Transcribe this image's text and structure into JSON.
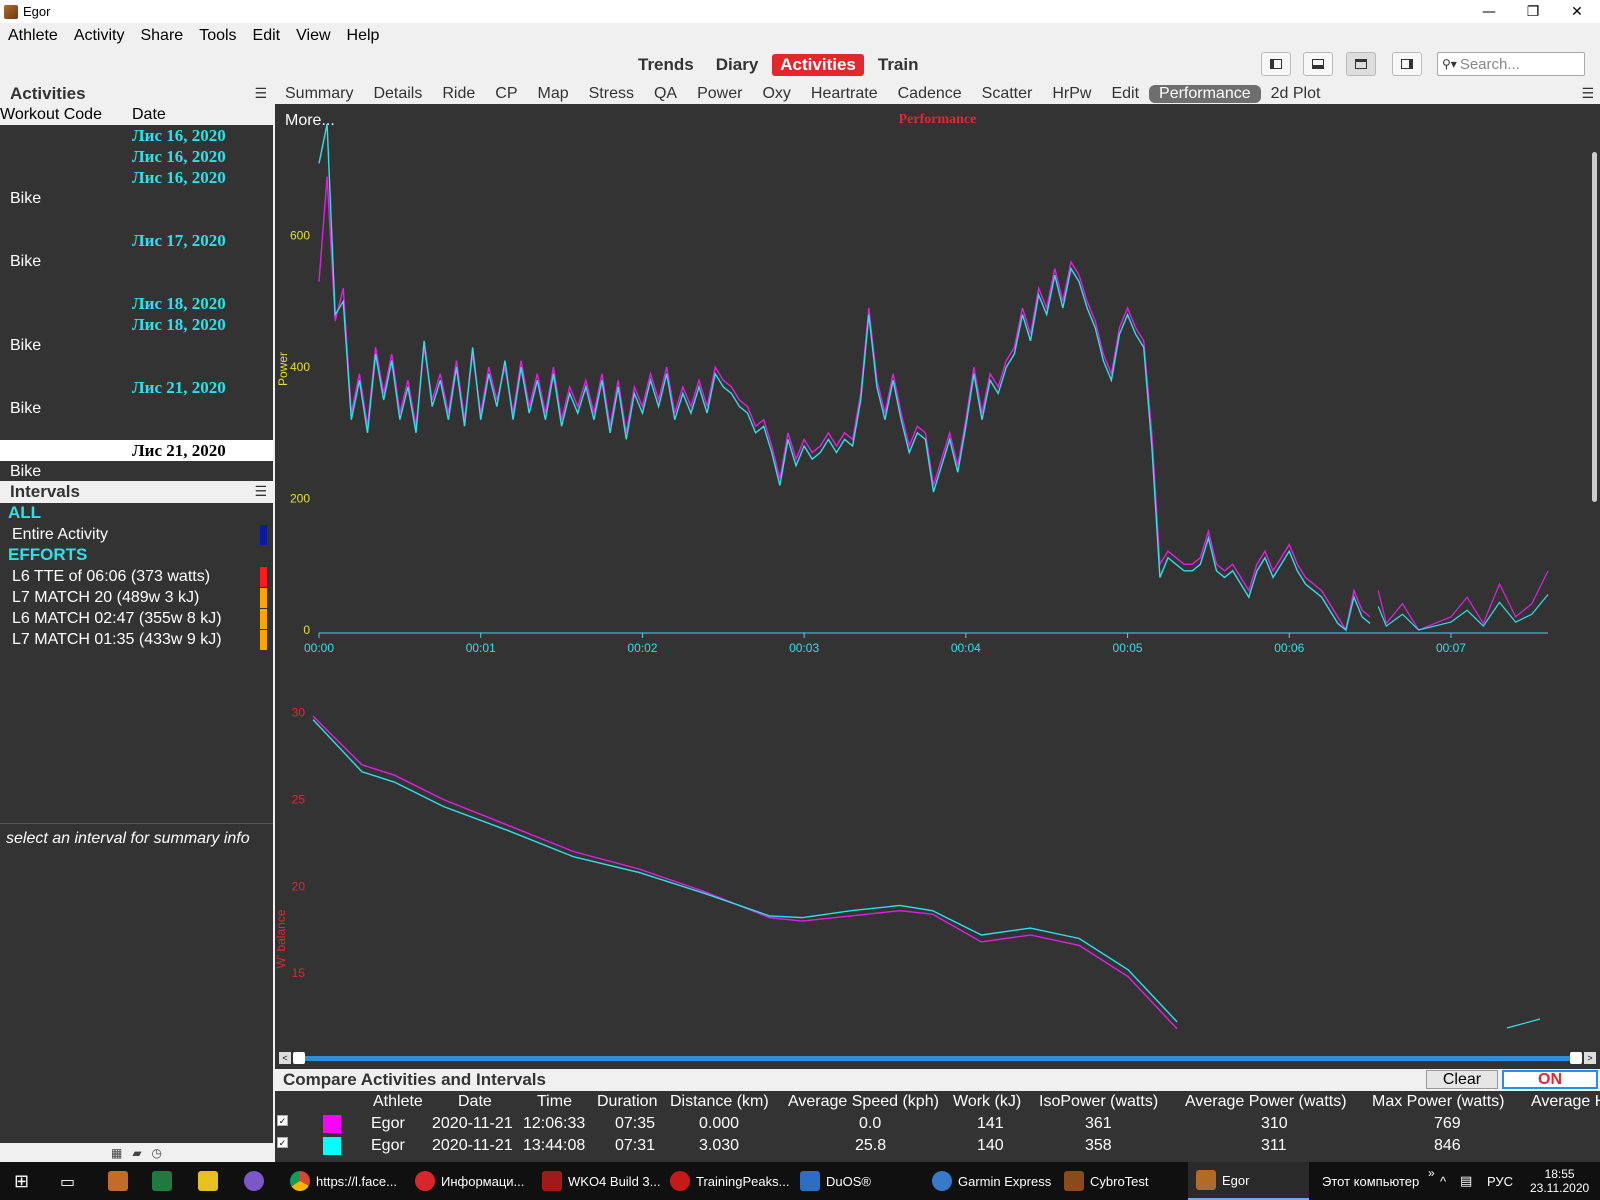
{
  "window": {
    "title": "Egor",
    "minimize": "—",
    "restore": "❐",
    "close": "✕"
  },
  "menu": [
    "Athlete",
    "Activity",
    "Share",
    "Tools",
    "Edit",
    "View",
    "Help"
  ],
  "views": {
    "trends": "Trends",
    "diary": "Diary",
    "activities": "Activities",
    "train": "Train"
  },
  "search": {
    "placeholder": "Search..."
  },
  "activities_panel": {
    "title": "Activities",
    "col_code": "Workout Code",
    "col_date": "Date",
    "rows": [
      {
        "date": "Лис 16, 2020",
        "code": ""
      },
      {
        "date": "Лис 16, 2020",
        "code": ""
      },
      {
        "date": "Лис 16, 2020",
        "code": "Bike"
      },
      {
        "date": "Лис 17, 2020",
        "code": "Bike"
      },
      {
        "date": "Лис 18, 2020",
        "code": ""
      },
      {
        "date": "Лис 18, 2020",
        "code": "Bike"
      },
      {
        "date": "Лис 21, 2020",
        "code": "Bike"
      },
      {
        "date": "Лис 21, 2020",
        "code": "Bike"
      }
    ]
  },
  "intervals_panel": {
    "title": "Intervals",
    "group_all": "ALL",
    "entire": "Entire Activity",
    "group_efforts": "EFFORTS",
    "efforts": [
      {
        "label": "L6 TTE of 06:06  (373 watts)",
        "color": "#ff1a1a"
      },
      {
        "label": "L7 MATCH 20 (489w 3 kJ)",
        "color": "#ffa500"
      },
      {
        "label": "L6 MATCH 02:47 (355w 8 kJ)",
        "color": "#ffa500"
      },
      {
        "label": "L7 MATCH 01:35 (433w 9 kJ)",
        "color": "#ffa500"
      }
    ],
    "entire_color": "#0a1aa0"
  },
  "summary_hint": "select an interval for summary info",
  "subtabs": [
    "Summary",
    "Details",
    "Ride",
    "CP",
    "Map",
    "Stress",
    "QA",
    "Power",
    "Oxy",
    "Heartrate",
    "Cadence",
    "Scatter",
    "HrPw",
    "Edit",
    "Performance",
    "2d Plot"
  ],
  "chart": {
    "more": "More...",
    "title": "Performance"
  },
  "chart_data": [
    {
      "type": "line",
      "ylabel": "Power",
      "ylim": [
        0,
        770
      ],
      "yticks": [
        0,
        200,
        400,
        600
      ],
      "xticks": [
        "00:00",
        "00:01",
        "00:02",
        "00:03",
        "00:04",
        "00:05",
        "00:06",
        "00:07"
      ],
      "xlim_min": [
        0,
        7.6
      ],
      "series": [
        {
          "color": "#e020e0",
          "x": [
            0,
            0.05,
            0.1,
            0.15,
            0.2,
            0.25,
            0.3,
            0.35,
            0.4,
            0.45,
            0.5,
            0.55,
            0.6,
            0.65,
            0.7,
            0.75,
            0.8,
            0.85,
            0.9,
            0.95,
            1.0,
            1.05,
            1.1,
            1.15,
            1.2,
            1.25,
            1.3,
            1.35,
            1.4,
            1.45,
            1.5,
            1.55,
            1.6,
            1.65,
            1.7,
            1.75,
            1.8,
            1.85,
            1.9,
            1.95,
            2.0,
            2.05,
            2.1,
            2.15,
            2.2,
            2.25,
            2.3,
            2.35,
            2.4,
            2.45,
            2.5,
            2.55,
            2.6,
            2.65,
            2.7,
            2.75,
            2.8,
            2.85,
            2.9,
            2.95,
            3.0,
            3.05,
            3.1,
            3.15,
            3.2,
            3.25,
            3.3,
            3.35,
            3.4,
            3.45,
            3.5,
            3.55,
            3.6,
            3.65,
            3.7,
            3.75,
            3.8,
            3.85,
            3.9,
            3.95,
            4.0,
            4.05,
            4.1,
            4.15,
            4.2,
            4.25,
            4.3,
            4.35,
            4.4,
            4.45,
            4.5,
            4.55,
            4.6,
            4.65,
            4.7,
            4.75,
            4.8,
            4.85,
            4.9,
            4.95,
            5.0,
            5.05,
            5.1,
            5.15,
            5.2,
            5.25,
            5.3,
            5.35,
            5.4,
            5.45,
            5.5,
            5.55,
            5.6,
            5.65,
            5.7,
            5.75,
            5.8,
            5.85,
            5.9,
            5.95,
            6.0,
            6.05,
            6.1,
            6.15,
            6.2,
            6.25,
            6.3,
            6.35,
            6.4,
            6.45,
            6.5
          ],
          "y": [
            530,
            690,
            470,
            520,
            330,
            390,
            310,
            430,
            360,
            420,
            330,
            380,
            310,
            430,
            350,
            390,
            330,
            410,
            320,
            420,
            330,
            400,
            350,
            400,
            330,
            410,
            340,
            390,
            330,
            400,
            320,
            370,
            340,
            380,
            330,
            390,
            310,
            380,
            300,
            370,
            340,
            390,
            350,
            400,
            330,
            370,
            340,
            380,
            340,
            400,
            380,
            370,
            350,
            340,
            310,
            320,
            280,
            230,
            300,
            260,
            290,
            270,
            280,
            300,
            280,
            300,
            290,
            360,
            490,
            380,
            330,
            390,
            330,
            280,
            310,
            300,
            220,
            260,
            300,
            250,
            320,
            400,
            330,
            390,
            370,
            410,
            430,
            490,
            450,
            520,
            490,
            550,
            500,
            560,
            540,
            500,
            470,
            420,
            390,
            460,
            490,
            460,
            440,
            300,
            100,
            120,
            110,
            100,
            100,
            110,
            150,
            100,
            90,
            100,
            80,
            60,
            100,
            120,
            90,
            110,
            130,
            100,
            80,
            70,
            60,
            40,
            20,
            0,
            60,
            30,
            20
          ]
        },
        {
          "color": "#2fe0e8",
          "x": [
            0,
            0.05,
            0.1,
            0.15,
            0.2,
            0.25,
            0.3,
            0.35,
            0.4,
            0.45,
            0.5,
            0.55,
            0.6,
            0.65,
            0.7,
            0.75,
            0.8,
            0.85,
            0.9,
            0.95,
            1.0,
            1.05,
            1.1,
            1.15,
            1.2,
            1.25,
            1.3,
            1.35,
            1.4,
            1.45,
            1.5,
            1.55,
            1.6,
            1.65,
            1.7,
            1.75,
            1.8,
            1.85,
            1.9,
            1.95,
            2.0,
            2.05,
            2.1,
            2.15,
            2.2,
            2.25,
            2.3,
            2.35,
            2.4,
            2.45,
            2.5,
            2.55,
            2.6,
            2.65,
            2.7,
            2.75,
            2.8,
            2.85,
            2.9,
            2.95,
            3.0,
            3.05,
            3.1,
            3.15,
            3.2,
            3.25,
            3.3,
            3.35,
            3.4,
            3.45,
            3.5,
            3.55,
            3.6,
            3.65,
            3.7,
            3.75,
            3.8,
            3.85,
            3.9,
            3.95,
            4.0,
            4.05,
            4.1,
            4.15,
            4.2,
            4.25,
            4.3,
            4.35,
            4.4,
            4.45,
            4.5,
            4.55,
            4.6,
            4.65,
            4.7,
            4.75,
            4.8,
            4.85,
            4.9,
            4.95,
            5.0,
            5.05,
            5.1,
            5.15,
            5.2,
            5.25,
            5.3,
            5.35,
            5.4,
            5.45,
            5.5,
            5.55,
            5.6,
            5.65,
            5.7,
            5.75,
            5.8,
            5.85,
            5.9,
            5.95,
            6.0,
            6.05,
            6.1,
            6.15,
            6.2,
            6.25,
            6.3,
            6.35,
            6.4,
            6.45,
            6.5
          ],
          "y": [
            710,
            800,
            480,
            500,
            320,
            380,
            300,
            420,
            350,
            410,
            320,
            370,
            300,
            440,
            340,
            380,
            320,
            400,
            310,
            430,
            320,
            390,
            340,
            410,
            320,
            400,
            330,
            380,
            320,
            390,
            310,
            360,
            330,
            370,
            320,
            380,
            300,
            370,
            290,
            360,
            330,
            380,
            340,
            390,
            320,
            360,
            330,
            370,
            330,
            390,
            370,
            360,
            340,
            330,
            300,
            310,
            270,
            220,
            290,
            250,
            280,
            260,
            270,
            290,
            270,
            290,
            280,
            350,
            480,
            370,
            320,
            380,
            320,
            270,
            300,
            290,
            210,
            250,
            290,
            240,
            310,
            390,
            320,
            380,
            360,
            400,
            420,
            480,
            440,
            510,
            480,
            540,
            490,
            550,
            530,
            490,
            460,
            410,
            380,
            450,
            480,
            450,
            430,
            280,
            80,
            110,
            100,
            90,
            90,
            100,
            140,
            90,
            80,
            90,
            70,
            50,
            90,
            110,
            80,
            100,
            120,
            90,
            70,
            60,
            50,
            30,
            10,
            0,
            50,
            20,
            10
          ]
        }
      ]
    },
    {
      "type": "line",
      "ylabel": "W' balance",
      "ylim": [
        11.5,
        30.5
      ],
      "yticks": [
        15,
        20,
        25,
        30
      ],
      "series": [
        {
          "color": "#e020e0",
          "x": [
            0,
            0.3,
            0.5,
            0.8,
            1.2,
            1.6,
            2.0,
            2.4,
            2.8,
            3.0,
            3.3,
            3.6,
            3.8,
            4.1,
            4.4,
            4.7,
            5.0,
            5.3
          ],
          "y": [
            29.8,
            27.0,
            26.4,
            25.0,
            23.5,
            22.0,
            21.0,
            19.7,
            18.2,
            18.0,
            18.3,
            18.6,
            18.4,
            16.8,
            17.2,
            16.6,
            14.8,
            11.8
          ]
        },
        {
          "color": "#2fe0e8",
          "x": [
            0,
            0.3,
            0.5,
            0.8,
            1.2,
            1.6,
            2.0,
            2.4,
            2.8,
            3.0,
            3.3,
            3.6,
            3.8,
            4.1,
            4.4,
            4.7,
            5.0,
            5.3
          ],
          "y": [
            29.6,
            26.6,
            26.0,
            24.6,
            23.2,
            21.7,
            20.8,
            19.6,
            18.3,
            18.2,
            18.6,
            18.9,
            18.6,
            17.2,
            17.6,
            17.0,
            15.2,
            12.2
          ]
        }
      ]
    }
  ],
  "compare": {
    "title": "Compare Activities and Intervals",
    "clear": "Clear",
    "on": "ON",
    "headers": [
      "Athlete",
      "Date",
      "Time",
      "Duration",
      "Distance (km)",
      "Average Speed (kph)",
      "Work (kJ)",
      "IsoPower (watts)",
      "Average Power (watts)",
      "Max Power (watts)",
      "Average H"
    ],
    "rows": [
      {
        "color": "#ff00ff",
        "athlete": "Egor",
        "date": "2020-11-21",
        "time": "12:06:33",
        "duration": "07:35",
        "distance": "0.000",
        "speed": "0.0",
        "work": "141",
        "iso": "361",
        "avgp": "310",
        "maxp": "769"
      },
      {
        "color": "#00ffff",
        "athlete": "Egor",
        "date": "2020-11-21",
        "time": "13:44:08",
        "duration": "07:31",
        "distance": "3.030",
        "speed": "25.8",
        "work": "140",
        "iso": "358",
        "avgp": "311",
        "maxp": "846"
      }
    ]
  },
  "taskbar": {
    "items": [
      "https://l.face...",
      "Информаци...",
      "WKO4 Build 3...",
      "TrainingPeaks...",
      "DuOS®",
      "Garmin Express",
      "CybroTest",
      "Egor"
    ],
    "tray_label": "Этот компьютер",
    "lang": "РУС",
    "time": "18:55",
    "date": "23.11.2020"
  }
}
